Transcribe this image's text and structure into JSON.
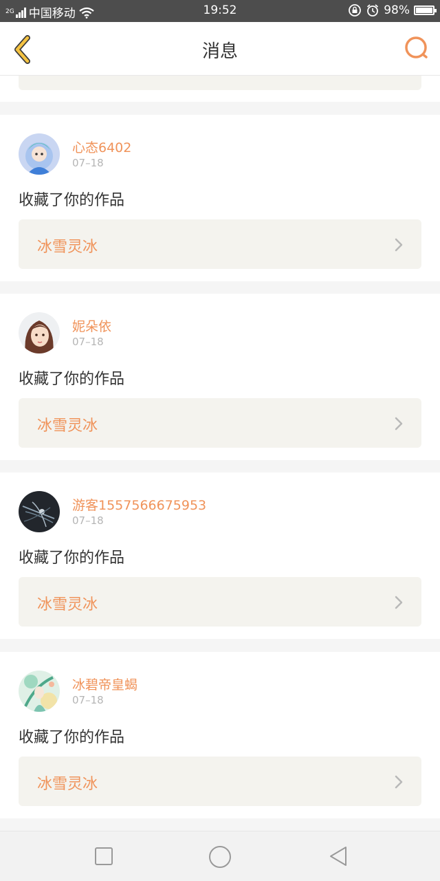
{
  "status_bar": {
    "network_type": "2G",
    "carrier": "中国移动",
    "time": "19:52",
    "battery": "98%",
    "battery_level": 0.98
  },
  "header": {
    "title": "消息",
    "back_icon": "chevron-left-icon",
    "search_icon": "search-icon"
  },
  "colors": {
    "accent": "#f0935a",
    "back_icon": "#f5c342",
    "card_box": "#f4f3ee"
  },
  "messages": [
    {
      "username": "心态6402",
      "date": "07–18",
      "action": "收藏了你的作品",
      "work_title": "冰雪灵冰"
    },
    {
      "username": "妮朵依",
      "date": "07–18",
      "action": "收藏了你的作品",
      "work_title": "冰雪灵冰"
    },
    {
      "username": "游客1557566675953",
      "date": "07–18",
      "action": "收藏了你的作品",
      "work_title": "冰雪灵冰"
    },
    {
      "username": "冰碧帝皇蝎",
      "date": "07–18",
      "action": "收藏了你的作品",
      "work_title": "冰雪灵冰"
    }
  ],
  "nav": {
    "recent_icon": "square-icon",
    "home_icon": "circle-icon",
    "back_icon": "triangle-back-icon"
  }
}
